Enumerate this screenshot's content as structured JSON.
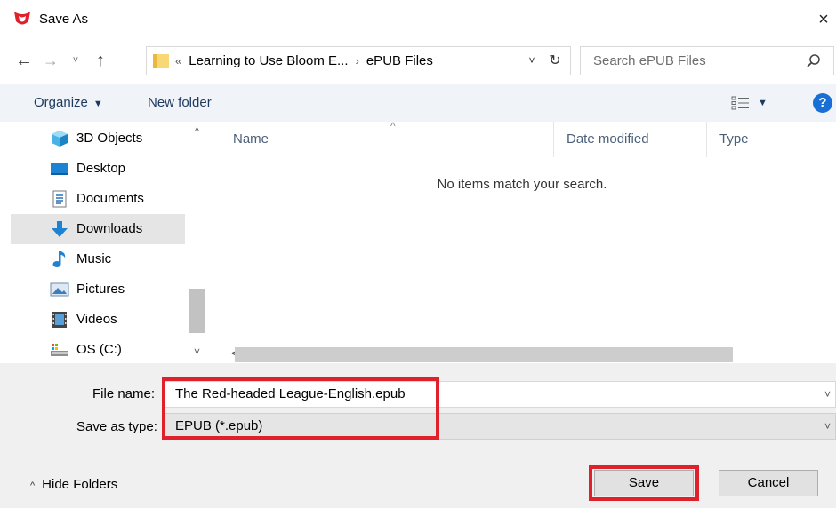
{
  "window": {
    "title": "Save As",
    "close_glyph": "×",
    "logo_icon": "bloom-logo-icon",
    "colors": {
      "logo": "#e0212b",
      "highlight": "#e0212b",
      "help": "#1a6fd6",
      "command_bar": "#f0f4f9"
    }
  },
  "nav": {
    "back_glyph": "←",
    "forward_glyph": "→",
    "recent_glyph": "˅",
    "up_glyph": "↑"
  },
  "address": {
    "overflow_glyph": "«",
    "crumbs": [
      "Learning to Use Bloom E...",
      "ePUB Files"
    ],
    "sep_glyph": "›",
    "dropdown_glyph": "˅",
    "refresh_glyph": "↻"
  },
  "search": {
    "placeholder": "Search ePUB Files"
  },
  "command_bar": {
    "organize_label": "Organize",
    "organize_caret": "▼",
    "new_folder_label": "New folder",
    "view_caret": "▼",
    "help_glyph": "?"
  },
  "sidebar": {
    "items": [
      {
        "label": "3D Objects",
        "icon": "3d-objects-icon"
      },
      {
        "label": "Desktop",
        "icon": "desktop-icon"
      },
      {
        "label": "Documents",
        "icon": "documents-icon"
      },
      {
        "label": "Downloads",
        "icon": "downloads-icon",
        "selected": true
      },
      {
        "label": "Music",
        "icon": "music-icon"
      },
      {
        "label": "Pictures",
        "icon": "pictures-icon"
      },
      {
        "label": "Videos",
        "icon": "videos-icon"
      },
      {
        "label": "OS (C:)",
        "icon": "drive-icon"
      }
    ],
    "scroll_up_glyph": "^",
    "scroll_down_glyph": "˅"
  },
  "file_list": {
    "sort_glyph": "^",
    "columns": [
      "Name",
      "Date modified",
      "Type"
    ],
    "empty_message": "No items match your search.",
    "scroll_left_glyph": "<"
  },
  "footer": {
    "file_name_label": "File name:",
    "file_name_value": "The Red-headed League-English.epub",
    "save_type_label": "Save as type:",
    "save_type_value": "EPUB (*.epub)",
    "dropdown_glyph": "˅",
    "hide_folders_caret": "^",
    "hide_folders_label": "Hide Folders",
    "save_label": "Save",
    "cancel_label": "Cancel"
  }
}
